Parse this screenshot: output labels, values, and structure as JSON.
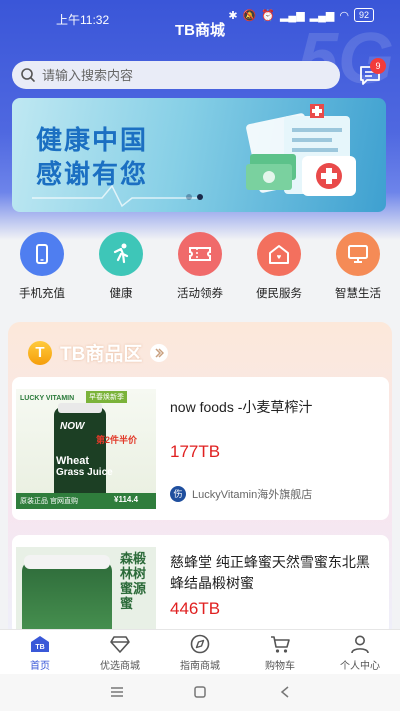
{
  "status_bar": {
    "time": "上午11:32",
    "battery": "92"
  },
  "app": {
    "title": "TB商城"
  },
  "search": {
    "placeholder": "请输入搜索内容"
  },
  "messages": {
    "badge": "9"
  },
  "banner": {
    "line1": "健康中国",
    "line2": "感谢有您",
    "slide_index": 2,
    "slide_count": 2
  },
  "categories": [
    {
      "label": "手机充值",
      "icon": "phone-icon",
      "color": "#4f7ef0"
    },
    {
      "label": "健康",
      "icon": "runner-icon",
      "color": "#3ec6b8"
    },
    {
      "label": "活动领券",
      "icon": "ticket-icon",
      "color": "#f06a6a"
    },
    {
      "label": "便民服务",
      "icon": "house-icon",
      "color": "#f3705e"
    },
    {
      "label": "智慧生活",
      "icon": "monitor-icon",
      "color": "#f58b56"
    }
  ],
  "zone": {
    "badge": "T",
    "title": "TB商品区"
  },
  "products": [
    {
      "title": "now foods -小麦草榨汁",
      "price": "177TB",
      "shop_badge": "伤",
      "shop": "LuckyVitamin海外旗舰店",
      "img_lines": {
        "brand": "LUCKY VITAMIN",
        "promo": "早春焕新季",
        "half": "第2件半价",
        "brand2": "NOW",
        "name1": "Wheat",
        "name2": "Grass Juice",
        "tag": "原装正品 官网直购",
        "price": "¥114.4"
      }
    },
    {
      "title": "慈蜂堂 纯正蜂蜜天然雪蜜东北黑蜂结晶椴树蜜",
      "price": "446TB",
      "img_lines": {
        "side": "森椴林树蜜源蜜"
      }
    }
  ],
  "tabs": [
    {
      "label": "首页",
      "icon": "home-icon",
      "active": true
    },
    {
      "label": "优选商城",
      "icon": "diamond-icon",
      "active": false
    },
    {
      "label": "指南商城",
      "icon": "compass-icon",
      "active": false
    },
    {
      "label": "购物车",
      "icon": "cart-icon",
      "active": false
    },
    {
      "label": "个人中心",
      "icon": "user-icon",
      "active": false
    }
  ],
  "colors": {
    "primary": "#3a58d8",
    "price": "#e02020"
  }
}
